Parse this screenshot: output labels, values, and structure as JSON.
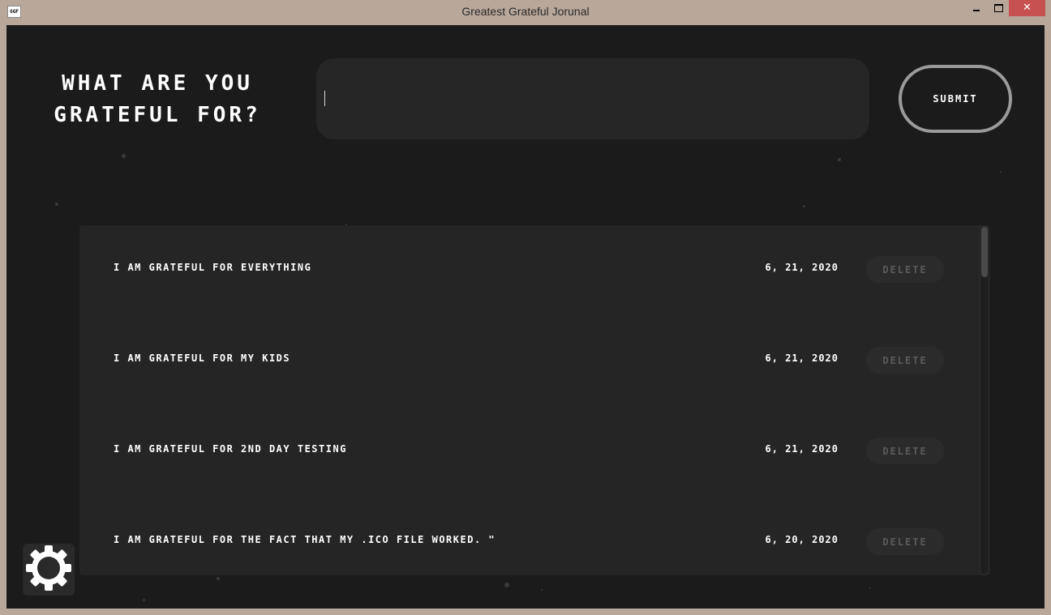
{
  "window": {
    "title": "Greatest Grateful Jorunal",
    "icon_label": "GGF",
    "close_glyph": "✕"
  },
  "header": {
    "prompt": "WHAT ARE YOU GRATEFUL FOR?",
    "input_value": "",
    "submit_label": "SUBMIT"
  },
  "entries": [
    {
      "text": "I AM GRATEFUL FOR EVERYTHING",
      "date": "6, 21, 2020",
      "delete_label": "DELETE"
    },
    {
      "text": "I AM GRATEFUL FOR MY KIDS",
      "date": "6, 21, 2020",
      "delete_label": "DELETE"
    },
    {
      "text": "I AM GRATEFUL FOR 2ND DAY TESTING",
      "date": "6, 21, 2020",
      "delete_label": "DELETE"
    },
    {
      "text": "I AM GRATEFUL FOR THE FACT THAT MY .ICO FILE WORKED. \"",
      "date": "6, 20, 2020",
      "delete_label": "DELETE"
    }
  ],
  "icons": {
    "settings": "gear-icon"
  },
  "colors": {
    "background": "#1b1b1b",
    "panel": "#252525",
    "text": "#ffffff",
    "delete_text": "#5a5a5a",
    "close_button": "#c75050"
  }
}
